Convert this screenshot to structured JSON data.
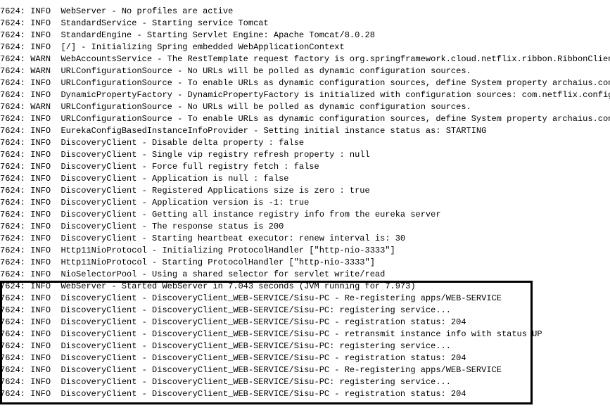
{
  "log": {
    "lines": [
      {
        "pid": "7624:",
        "level": "INFO",
        "message": "WebServer - No profiles are active"
      },
      {
        "pid": "7624:",
        "level": "INFO",
        "message": "StandardService - Starting service Tomcat"
      },
      {
        "pid": "7624:",
        "level": "INFO",
        "message": "StandardEngine - Starting Servlet Engine: Apache Tomcat/8.0.28"
      },
      {
        "pid": "7624:",
        "level": "INFO",
        "message": "[/] - Initializing Spring embedded WebApplicationContext"
      },
      {
        "pid": "7624:",
        "level": "WARN",
        "message": "WebAccountsService - The RestTemplate request factory is org.springframework.cloud.netflix.ribbon.RibbonClientHt"
      },
      {
        "pid": "7624:",
        "level": "WARN",
        "message": "URLConfigurationSource - No URLs will be polled as dynamic configuration sources."
      },
      {
        "pid": "7624:",
        "level": "INFO",
        "message": "URLConfigurationSource - To enable URLs as dynamic configuration sources, define System property archaius.config"
      },
      {
        "pid": "7624:",
        "level": "INFO",
        "message": "DynamicPropertyFactory - DynamicPropertyFactory is initialized with configuration sources: com.netflix.config.Co"
      },
      {
        "pid": "7624:",
        "level": "WARN",
        "message": "URLConfigurationSource - No URLs will be polled as dynamic configuration sources."
      },
      {
        "pid": "7624:",
        "level": "INFO",
        "message": "URLConfigurationSource - To enable URLs as dynamic configuration sources, define System property archaius.config"
      },
      {
        "pid": "7624:",
        "level": "INFO",
        "message": "EurekaConfigBasedInstanceInfoProvider - Setting initial instance status as: STARTING"
      },
      {
        "pid": "7624:",
        "level": "INFO",
        "message": "DiscoveryClient - Disable delta property : false"
      },
      {
        "pid": "7624:",
        "level": "INFO",
        "message": "DiscoveryClient - Single vip registry refresh property : null"
      },
      {
        "pid": "7624:",
        "level": "INFO",
        "message": "DiscoveryClient - Force full registry fetch : false"
      },
      {
        "pid": "7624:",
        "level": "INFO",
        "message": "DiscoveryClient - Application is null : false"
      },
      {
        "pid": "7624:",
        "level": "INFO",
        "message": "DiscoveryClient - Registered Applications size is zero : true"
      },
      {
        "pid": "7624:",
        "level": "INFO",
        "message": "DiscoveryClient - Application version is -1: true"
      },
      {
        "pid": "7624:",
        "level": "INFO",
        "message": "DiscoveryClient - Getting all instance registry info from the eureka server"
      },
      {
        "pid": "7624:",
        "level": "INFO",
        "message": "DiscoveryClient - The response status is 200"
      },
      {
        "pid": "7624:",
        "level": "INFO",
        "message": "DiscoveryClient - Starting heartbeat executor: renew interval is: 30"
      },
      {
        "pid": "7624:",
        "level": "INFO",
        "message": "Http11NioProtocol - Initializing ProtocolHandler [\"http-nio-3333\"]"
      },
      {
        "pid": "7624:",
        "level": "INFO",
        "message": "Http11NioProtocol - Starting ProtocolHandler [\"http-nio-3333\"]"
      },
      {
        "pid": "7624:",
        "level": "INFO",
        "message": "NioSelectorPool - Using a shared selector for servlet write/read"
      },
      {
        "pid": "7624:",
        "level": "INFO",
        "message": "WebServer - Started WebServer in 7.043 seconds (JVM running for 7.973)"
      },
      {
        "pid": "7624:",
        "level": "INFO",
        "message": "DiscoveryClient - DiscoveryClient_WEB-SERVICE/Sisu-PC - Re-registering apps/WEB-SERVICE"
      },
      {
        "pid": "7624:",
        "level": "INFO",
        "message": "DiscoveryClient - DiscoveryClient_WEB-SERVICE/Sisu-PC: registering service..."
      },
      {
        "pid": "7624:",
        "level": "INFO",
        "message": "DiscoveryClient - DiscoveryClient_WEB-SERVICE/Sisu-PC - registration status: 204"
      },
      {
        "pid": "7624:",
        "level": "INFO",
        "message": "DiscoveryClient - DiscoveryClient_WEB-SERVICE/Sisu-PC - retransmit instance info with status UP"
      },
      {
        "pid": "7624:",
        "level": "INFO",
        "message": "DiscoveryClient - DiscoveryClient_WEB-SERVICE/Sisu-PC: registering service..."
      },
      {
        "pid": "7624:",
        "level": "INFO",
        "message": "DiscoveryClient - DiscoveryClient_WEB-SERVICE/Sisu-PC - registration status: 204"
      },
      {
        "pid": "7624:",
        "level": "INFO",
        "message": "DiscoveryClient - DiscoveryClient_WEB-SERVICE/Sisu-PC - Re-registering apps/WEB-SERVICE"
      },
      {
        "pid": "7624:",
        "level": "INFO",
        "message": "DiscoveryClient - DiscoveryClient_WEB-SERVICE/Sisu-PC: registering service..."
      },
      {
        "pid": "7624:",
        "level": "INFO",
        "message": "DiscoveryClient - DiscoveryClient_WEB-SERVICE/Sisu-PC - registration status: 204"
      }
    ]
  },
  "colors": {
    "text": "#000000",
    "background": "#ffffff",
    "highlight_border": "#000000"
  }
}
